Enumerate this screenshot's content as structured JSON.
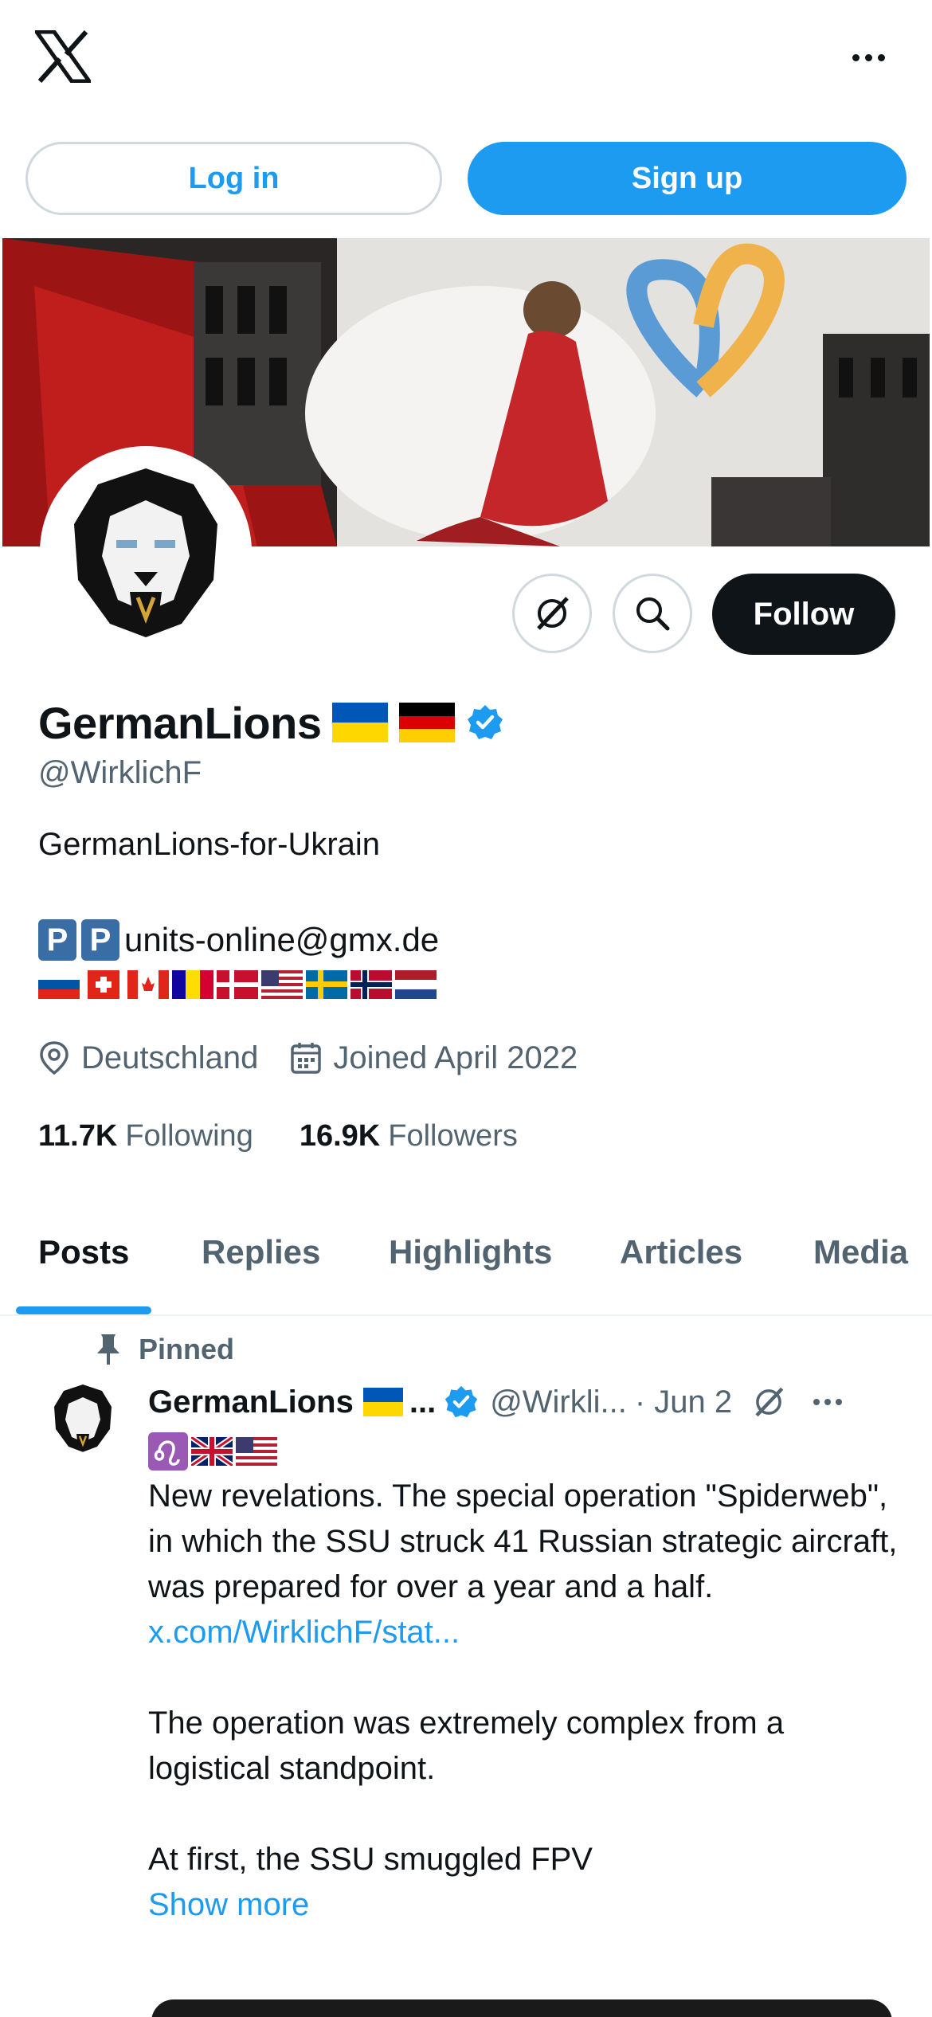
{
  "auth": {
    "login_label": "Log in",
    "signup_label": "Sign up"
  },
  "profile": {
    "display_name": "GermanLions",
    "handle": "@WirklichF",
    "bio": "GermanLions-for-Ukrain",
    "contact_letters": [
      "P",
      "P"
    ],
    "contact_email": "units-online@gmx.de",
    "location": "Deutschland",
    "joined": "Joined April 2022",
    "following_count": "11.7K",
    "following_label": "Following",
    "followers_count": "16.9K",
    "followers_label": "Followers",
    "follow_label": "Follow",
    "flags": [
      "slovenia",
      "switzerland",
      "canada",
      "andorra",
      "denmark",
      "usa",
      "sweden",
      "norway",
      "netherlands"
    ]
  },
  "tabs": [
    "Posts",
    "Replies",
    "Highlights",
    "Articles",
    "Media"
  ],
  "pinned_post": {
    "pinned_label": "Pinned",
    "author_name": "GermanLions",
    "ellipsis": "...",
    "author_handle": "@Wirkli...",
    "date": "· Jun 2",
    "paragraph_1": "New revelations. The special operation \"Spiderweb\", in which the SSU struck 41 Russian strategic aircraft, was prepared for over a year and a half.",
    "link": "x.com/WirklichF/stat...",
    "paragraph_2": "The operation was extremely complex from a logistical standpoint.",
    "paragraph_3": "At first, the SSU smuggled FPV",
    "show_more": "Show more"
  },
  "colors": {
    "accent": "#1d9bf0",
    "text": "#0f1419",
    "muted": "#536471",
    "follow_bg": "#0f1419"
  },
  "icons": [
    "x-logo-icon",
    "more-icon",
    "grok-icon",
    "search-icon",
    "verified-badge-icon",
    "location-icon",
    "calendar-icon",
    "pin-icon"
  ]
}
